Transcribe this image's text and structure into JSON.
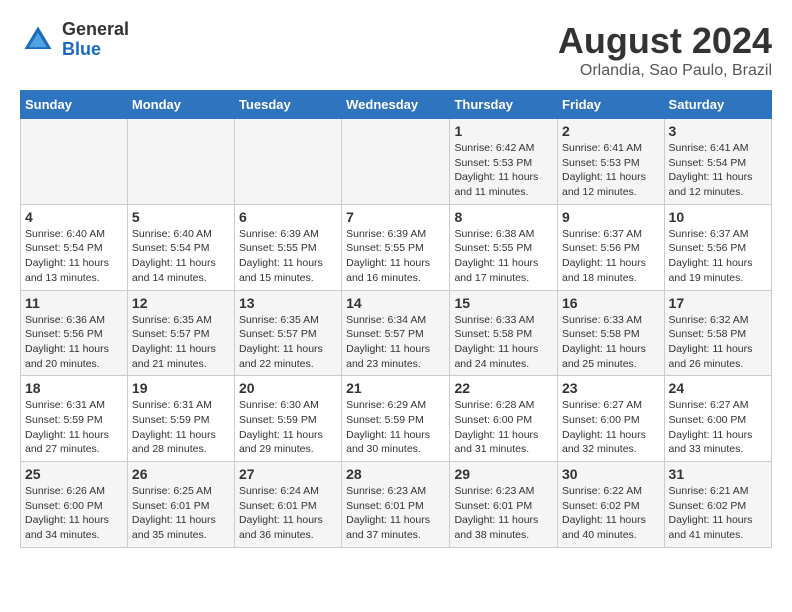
{
  "header": {
    "logo_general": "General",
    "logo_blue": "Blue",
    "month_year": "August 2024",
    "location": "Orlandia, Sao Paulo, Brazil"
  },
  "days_of_week": [
    "Sunday",
    "Monday",
    "Tuesday",
    "Wednesday",
    "Thursday",
    "Friday",
    "Saturday"
  ],
  "weeks": [
    [
      {
        "day": "",
        "info": ""
      },
      {
        "day": "",
        "info": ""
      },
      {
        "day": "",
        "info": ""
      },
      {
        "day": "",
        "info": ""
      },
      {
        "day": "1",
        "info": "Sunrise: 6:42 AM\nSunset: 5:53 PM\nDaylight: 11 hours and 11 minutes."
      },
      {
        "day": "2",
        "info": "Sunrise: 6:41 AM\nSunset: 5:53 PM\nDaylight: 11 hours and 12 minutes."
      },
      {
        "day": "3",
        "info": "Sunrise: 6:41 AM\nSunset: 5:54 PM\nDaylight: 11 hours and 12 minutes."
      }
    ],
    [
      {
        "day": "4",
        "info": "Sunrise: 6:40 AM\nSunset: 5:54 PM\nDaylight: 11 hours and 13 minutes."
      },
      {
        "day": "5",
        "info": "Sunrise: 6:40 AM\nSunset: 5:54 PM\nDaylight: 11 hours and 14 minutes."
      },
      {
        "day": "6",
        "info": "Sunrise: 6:39 AM\nSunset: 5:55 PM\nDaylight: 11 hours and 15 minutes."
      },
      {
        "day": "7",
        "info": "Sunrise: 6:39 AM\nSunset: 5:55 PM\nDaylight: 11 hours and 16 minutes."
      },
      {
        "day": "8",
        "info": "Sunrise: 6:38 AM\nSunset: 5:55 PM\nDaylight: 11 hours and 17 minutes."
      },
      {
        "day": "9",
        "info": "Sunrise: 6:37 AM\nSunset: 5:56 PM\nDaylight: 11 hours and 18 minutes."
      },
      {
        "day": "10",
        "info": "Sunrise: 6:37 AM\nSunset: 5:56 PM\nDaylight: 11 hours and 19 minutes."
      }
    ],
    [
      {
        "day": "11",
        "info": "Sunrise: 6:36 AM\nSunset: 5:56 PM\nDaylight: 11 hours and 20 minutes."
      },
      {
        "day": "12",
        "info": "Sunrise: 6:35 AM\nSunset: 5:57 PM\nDaylight: 11 hours and 21 minutes."
      },
      {
        "day": "13",
        "info": "Sunrise: 6:35 AM\nSunset: 5:57 PM\nDaylight: 11 hours and 22 minutes."
      },
      {
        "day": "14",
        "info": "Sunrise: 6:34 AM\nSunset: 5:57 PM\nDaylight: 11 hours and 23 minutes."
      },
      {
        "day": "15",
        "info": "Sunrise: 6:33 AM\nSunset: 5:58 PM\nDaylight: 11 hours and 24 minutes."
      },
      {
        "day": "16",
        "info": "Sunrise: 6:33 AM\nSunset: 5:58 PM\nDaylight: 11 hours and 25 minutes."
      },
      {
        "day": "17",
        "info": "Sunrise: 6:32 AM\nSunset: 5:58 PM\nDaylight: 11 hours and 26 minutes."
      }
    ],
    [
      {
        "day": "18",
        "info": "Sunrise: 6:31 AM\nSunset: 5:59 PM\nDaylight: 11 hours and 27 minutes."
      },
      {
        "day": "19",
        "info": "Sunrise: 6:31 AM\nSunset: 5:59 PM\nDaylight: 11 hours and 28 minutes."
      },
      {
        "day": "20",
        "info": "Sunrise: 6:30 AM\nSunset: 5:59 PM\nDaylight: 11 hours and 29 minutes."
      },
      {
        "day": "21",
        "info": "Sunrise: 6:29 AM\nSunset: 5:59 PM\nDaylight: 11 hours and 30 minutes."
      },
      {
        "day": "22",
        "info": "Sunrise: 6:28 AM\nSunset: 6:00 PM\nDaylight: 11 hours and 31 minutes."
      },
      {
        "day": "23",
        "info": "Sunrise: 6:27 AM\nSunset: 6:00 PM\nDaylight: 11 hours and 32 minutes."
      },
      {
        "day": "24",
        "info": "Sunrise: 6:27 AM\nSunset: 6:00 PM\nDaylight: 11 hours and 33 minutes."
      }
    ],
    [
      {
        "day": "25",
        "info": "Sunrise: 6:26 AM\nSunset: 6:00 PM\nDaylight: 11 hours and 34 minutes."
      },
      {
        "day": "26",
        "info": "Sunrise: 6:25 AM\nSunset: 6:01 PM\nDaylight: 11 hours and 35 minutes."
      },
      {
        "day": "27",
        "info": "Sunrise: 6:24 AM\nSunset: 6:01 PM\nDaylight: 11 hours and 36 minutes."
      },
      {
        "day": "28",
        "info": "Sunrise: 6:23 AM\nSunset: 6:01 PM\nDaylight: 11 hours and 37 minutes."
      },
      {
        "day": "29",
        "info": "Sunrise: 6:23 AM\nSunset: 6:01 PM\nDaylight: 11 hours and 38 minutes."
      },
      {
        "day": "30",
        "info": "Sunrise: 6:22 AM\nSunset: 6:02 PM\nDaylight: 11 hours and 40 minutes."
      },
      {
        "day": "31",
        "info": "Sunrise: 6:21 AM\nSunset: 6:02 PM\nDaylight: 11 hours and 41 minutes."
      }
    ]
  ]
}
